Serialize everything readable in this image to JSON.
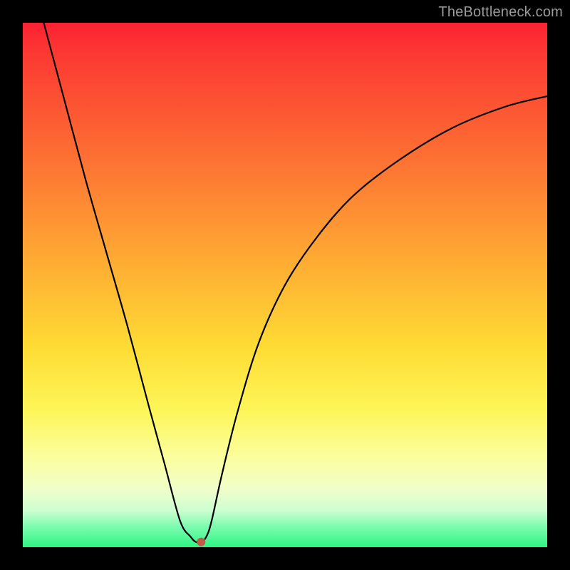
{
  "watermark": "TheBottleneck.com",
  "chart_data": {
    "type": "line",
    "title": "",
    "xlabel": "",
    "ylabel": "",
    "xlim": [
      0,
      100
    ],
    "ylim": [
      0,
      100
    ],
    "grid": false,
    "legend": false,
    "series": [
      {
        "name": "curve",
        "x": [
          4,
          8,
          12,
          16,
          20,
          24,
          27,
          30,
          32,
          33,
          34,
          35,
          36,
          38,
          41,
          45,
          50,
          56,
          63,
          72,
          82,
          92,
          100
        ],
        "y": [
          100,
          85,
          70,
          56,
          42,
          27,
          16,
          5,
          2,
          1,
          1,
          2,
          5,
          14,
          26,
          39,
          50,
          59,
          67,
          74,
          80,
          84,
          86
        ]
      }
    ],
    "marker": {
      "x": 34,
      "y": 1,
      "color": "#c35a4a"
    },
    "gradient_stops": [
      {
        "pos": 0,
        "color": "#fb2132"
      },
      {
        "pos": 25,
        "color": "#fd6e33"
      },
      {
        "pos": 50,
        "color": "#fec033"
      },
      {
        "pos": 75,
        "color": "#fcfa73"
      },
      {
        "pos": 100,
        "color": "#2df683"
      }
    ]
  }
}
